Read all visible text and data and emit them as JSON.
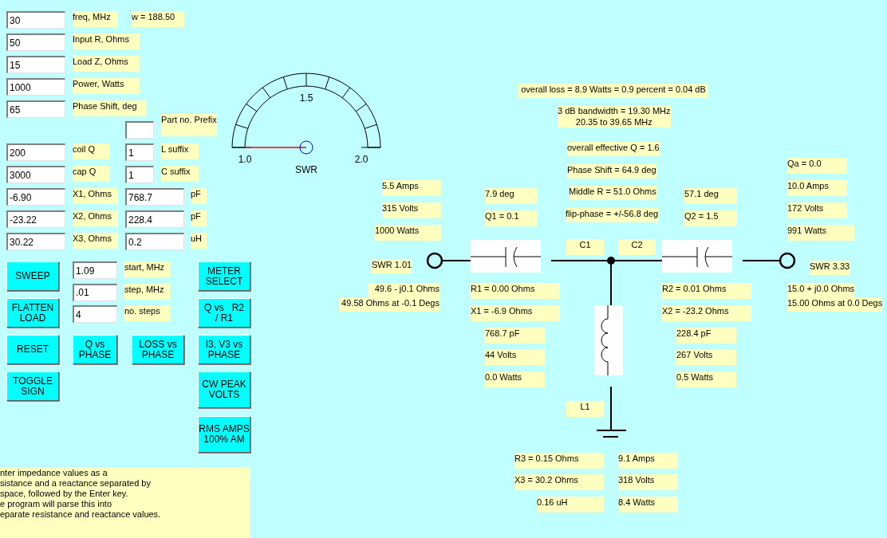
{
  "parameters": [
    {
      "value": "30",
      "label": "freq, MHz"
    },
    {
      "value": "50",
      "label": "Input R, Ohms"
    },
    {
      "value": "15",
      "label": "Load Z, Ohms"
    },
    {
      "value": "1000",
      "label": "Power, Watts"
    },
    {
      "value": "65",
      "label": "Phase Shift, deg"
    }
  ],
  "omega": "w = 188.50",
  "part_prefix": {
    "label": "Part no. Prefix"
  },
  "q_fields": [
    {
      "value": "200",
      "label": "coil Q",
      "suffix_value": "1",
      "suffix_label": "L suffix"
    },
    {
      "value": "3000",
      "label": "cap Q",
      "suffix_value": "1",
      "suffix_label": "C suffix"
    }
  ],
  "reactances": [
    {
      "value": "-6.90",
      "label": "X1, Ohms",
      "component_value": "768.7",
      "unit": "pF"
    },
    {
      "value": "-23.22",
      "label": "X2, Ohms",
      "component_value": "228.4",
      "unit": "pF"
    },
    {
      "value": "30.22",
      "label": "X3, Ohms",
      "component_value": "0.2",
      "unit": "uH"
    }
  ],
  "sweep_fields": [
    {
      "value": "1.09",
      "label": "start, MHz"
    },
    {
      "value": ".01",
      "label": "step, MHz"
    },
    {
      "value": "4",
      "label": "no. steps"
    }
  ],
  "buttons": [
    {
      "label": "SWEEP"
    },
    {
      "label": "FLATTEN\nLOAD"
    },
    {
      "label": "RESET"
    },
    {
      "label": "TOGGLE\nSIGN"
    },
    {
      "label": "Q vs\nPHASE"
    },
    {
      "label": "LOSS vs\nPHASE"
    },
    {
      "label": "METER\nSELECT"
    },
    {
      "label": "Q vs   R2\n/ R1"
    },
    {
      "label": "I3, V3 vs\nPHASE"
    },
    {
      "label": "CW PEAK\nVOLTS"
    },
    {
      "label": "RMS AMPS\n100% AM"
    }
  ],
  "meter": {
    "ticks": [
      "1.0",
      "1.5",
      "2.0"
    ],
    "label": "SWR"
  },
  "help_text": "nter impedance values as a\nsistance and a reactance separated by\nspace, followed by the Enter key.\ne program will parse this into\neparate resistance and reactance values.",
  "summary": [
    "overall loss = 8.9 Watts = 0.9 percent = 0.04 dB",
    "3 dB bandwidth = 19.30 MHz\n20.35 to 39.65 MHz",
    "overall effective Q = 1.6",
    "Phase Shift = 64.9 deg",
    "Middle R = 51.0 Ohms",
    "flip-phase = +/-56.8 deg"
  ],
  "input_side": [
    "5.5 Amps",
    "315 Volts",
    "1000 Watts",
    "SWR 1.01",
    "49.6 - j0.1 Ohms",
    "49.58 Ohms at -0.1 Degs"
  ],
  "c1": [
    "7.9 deg",
    "Q1 = 0.1",
    "C1",
    "R1 = 0.00 Ohms",
    "X1 = -6.9 Ohms",
    "768.7 pF",
    "44 Volts",
    "0.0 Watts"
  ],
  "c2": [
    "57.1 deg",
    "Q2 = 1.5",
    "C2",
    "R2 = 0.01 Ohms",
    "X2 = -23.2 Ohms",
    "228.4 pF",
    "267 Volts",
    "0.5 Watts"
  ],
  "output_side": [
    "Qa = 0.0",
    "10.0 Amps",
    "172 Volts",
    "991 Watts",
    "SWR 3.33",
    "15.0 + j0.0 Ohms",
    "15.00 Ohms at 0.0 Degs"
  ],
  "l1": [
    "L1",
    "R3 = 0.15 Ohms",
    "X3 = 30.2 Ohms",
    "0.16 uH",
    "9.1 Amps",
    "318 Volts",
    "8.4 Watts"
  ]
}
